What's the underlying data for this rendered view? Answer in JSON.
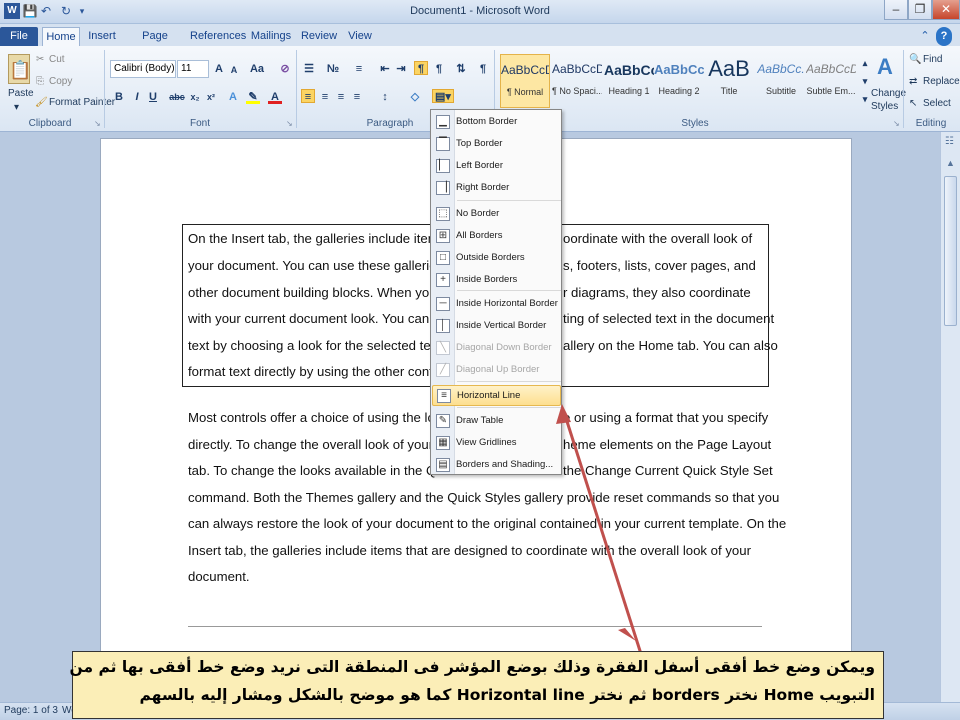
{
  "titlebar": {
    "title": "Document1 - Microsoft Word"
  },
  "tabs": [
    "File",
    "Home",
    "Insert",
    "Page Layout",
    "References",
    "Mailings",
    "Review",
    "View"
  ],
  "ribbon": {
    "clipboard": {
      "paste": "Paste",
      "cut": "Cut",
      "copy": "Copy",
      "format_painter": "Format Painter",
      "label": "Clipboard"
    },
    "font": {
      "name": "Calibri (Body)",
      "size": "11",
      "label": "Font",
      "buttons": [
        "B",
        "I",
        "U",
        "abc",
        "x₂",
        "x²"
      ]
    },
    "paragraph": {
      "label": "Paragraph"
    },
    "styles": {
      "label": "Styles",
      "items": [
        {
          "sample": "AaBbCcDc",
          "name": "¶ Normal"
        },
        {
          "sample": "AaBbCcDc",
          "name": "¶ No Spaci..."
        },
        {
          "sample": "AaBbCc",
          "name": "Heading 1"
        },
        {
          "sample": "AaBbCc",
          "name": "Heading 2"
        },
        {
          "sample": "AaB",
          "name": "Title"
        },
        {
          "sample": "AaBbCc.",
          "name": "Subtitle"
        },
        {
          "sample": "AaBbCcDc",
          "name": "Subtle Em..."
        }
      ],
      "change_styles": [
        "Change",
        "Styles"
      ]
    },
    "editing": {
      "find": "Find",
      "replace": "Replace",
      "select": "Select",
      "label": "Editing"
    }
  },
  "document": {
    "bordered_lines": [
      "On the Insert tab, the galleries include items",
      "your document. You can use these galleries",
      "other document building blocks. When you c",
      "with your current document look. You can e",
      "text by choosing a look for the selected  text",
      "format text directly by using the other contro"
    ],
    "bordered_right": [
      "oordinate with the overall look of",
      "s, footers, lists, cover pages, and",
      "r diagrams, they also coordinate",
      "ting of selected text in the document",
      "allery on the Home tab. You can also",
      ""
    ],
    "para_lines": [
      "Most controls offer a choice of using the loo",
      "directly. To change the overall look of your d",
      "tab. To change the looks available in the Quic",
      "command. Both the Themes gallery and the Quick Styles gallery provide reset commands so that you",
      "can always restore the look of your document to the original contained in your current template.  On the",
      "Insert tab, the galleries include items that are designed to coordinate with the overall look of your",
      "document."
    ],
    "para_right": [
      "e or using a format that you specify",
      "heme elements  on the Page Layout",
      "  the Change Current Quick Style Set",
      "",
      "",
      "",
      ""
    ]
  },
  "menu": [
    {
      "label": "Bottom Border",
      "icon": "bottom-border-icon",
      "glyph": "▁",
      "state": "normal"
    },
    {
      "label": "Top Border",
      "icon": "top-border-icon",
      "glyph": "▔",
      "state": "normal"
    },
    {
      "label": "Left Border",
      "icon": "left-border-icon",
      "glyph": "▏",
      "state": "normal"
    },
    {
      "label": "Right Border",
      "icon": "right-border-icon",
      "glyph": "▕",
      "state": "normal"
    },
    {
      "label": "No Border",
      "icon": "no-border-icon",
      "glyph": "⬚",
      "state": "normal"
    },
    {
      "label": "All Borders",
      "icon": "all-borders-icon",
      "glyph": "⊞",
      "state": "normal"
    },
    {
      "label": "Outside Borders",
      "icon": "outside-borders-icon",
      "glyph": "□",
      "state": "normal"
    },
    {
      "label": "Inside Borders",
      "icon": "inside-borders-icon",
      "glyph": "+",
      "state": "normal"
    },
    {
      "label": "Inside Horizontal Border",
      "icon": "inside-horizontal-border-icon",
      "glyph": "─",
      "state": "normal"
    },
    {
      "label": "Inside Vertical Border",
      "icon": "inside-vertical-border-icon",
      "glyph": "│",
      "state": "normal"
    },
    {
      "label": "Diagonal Down Border",
      "icon": "diagonal-down-border-icon",
      "glyph": "╲",
      "state": "disabled"
    },
    {
      "label": "Diagonal Up Border",
      "icon": "diagonal-up-border-icon",
      "glyph": "╱",
      "state": "disabled"
    },
    {
      "label": "Horizontal Line",
      "icon": "horizontal-line-icon",
      "glyph": "≡",
      "state": "hover"
    },
    {
      "label": "Draw Table",
      "icon": "draw-table-icon",
      "glyph": "✎",
      "state": "normal"
    },
    {
      "label": "View Gridlines",
      "icon": "view-gridlines-icon",
      "glyph": "▦",
      "state": "normal"
    },
    {
      "label": "Borders and Shading...",
      "icon": "borders-shading-icon",
      "glyph": "▤",
      "state": "normal"
    }
  ],
  "statusbar": {
    "page": "Page: 1 of 3",
    "words": "Wo"
  },
  "annotation": {
    "line1": "ويمكن وضع خط أفقى أسفل الفقرة وذلك بوضع المؤشر فى المنطقة التى نريد وضع خط أفقى بها ثم من",
    "line2": "التبويب Home نختر borders ثم نختر Horizontal line كما هو موضح بالشكل ومشار إليه بالسهم"
  },
  "colors": {
    "file_tab": "#2b579a",
    "hover": "#fddf8f",
    "annotation_bg": "#fbeeb7",
    "arrow": "#c0504d"
  }
}
